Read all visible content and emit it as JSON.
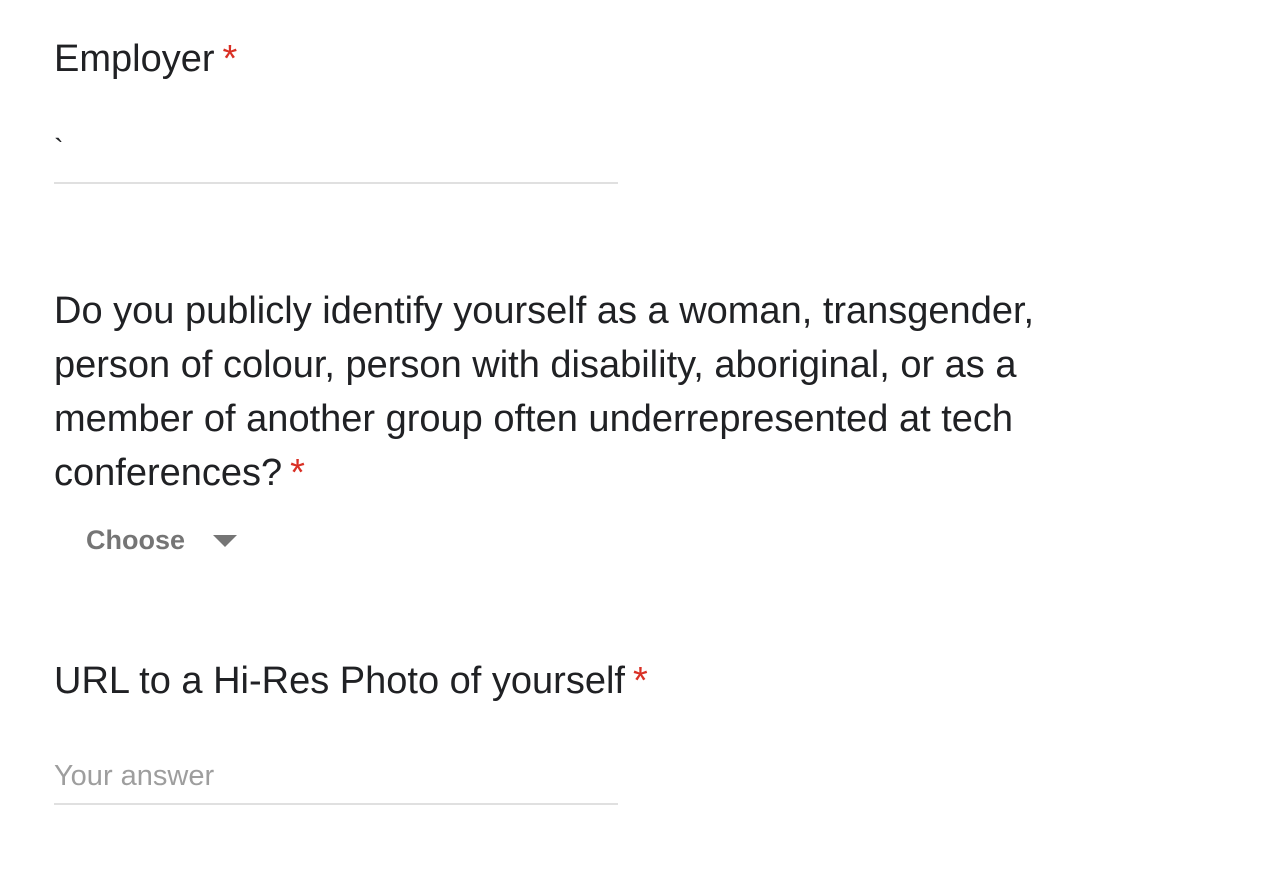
{
  "form": {
    "employer": {
      "title": "Employer",
      "required_mark": "*",
      "value": "`"
    },
    "underrepresented": {
      "title_lines": [
        "Do you publicly identify yourself as a woman, transgender,",
        "person of colour, person with disability, aboriginal, or as a",
        "member of another group often underrepresented at tech",
        "conferences?"
      ],
      "required_mark": "*",
      "dropdown_selected": "Choose"
    },
    "photo_url": {
      "title": "URL to a Hi-Res Photo of yourself",
      "required_mark": "*",
      "placeholder": "Your answer",
      "value": ""
    }
  },
  "colors": {
    "required": "#d93025",
    "text": "#202124",
    "placeholder": "#9e9e9e",
    "underline": "#e0e0e0",
    "dropdown_text": "#757575"
  },
  "icons": {
    "dropdown": "triangle-down-icon"
  }
}
